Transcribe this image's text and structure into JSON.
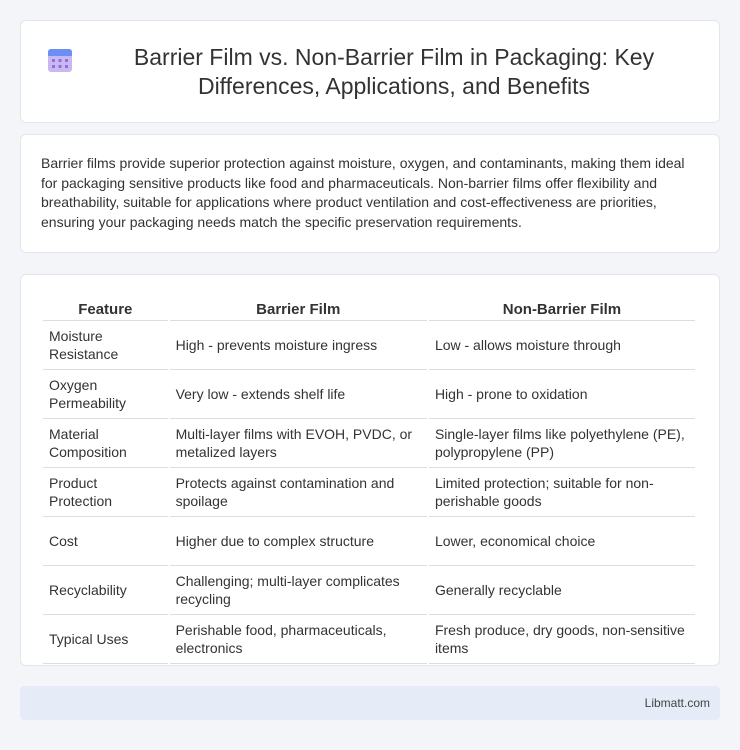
{
  "header": {
    "icon": "calendar-icon",
    "title": "Barrier Film vs. Non-Barrier Film in Packaging: Key Differences, Applications, and Benefits"
  },
  "intro": "Barrier films provide superior protection against moisture, oxygen, and contaminants, making them ideal for packaging sensitive products like food and pharmaceuticals. Non-barrier films offer flexibility and breathability, suitable for applications where product ventilation and cost-effectiveness are priorities, ensuring your packaging needs match the specific preservation requirements.",
  "table": {
    "headers": [
      "Feature",
      "Barrier Film",
      "Non-Barrier Film"
    ],
    "rows": [
      [
        "Moisture Resistance",
        "High - prevents moisture ingress",
        "Low - allows moisture through"
      ],
      [
        "Oxygen Permeability",
        "Very low - extends shelf life",
        "High - prone to oxidation"
      ],
      [
        "Material Composition",
        "Multi-layer films with EVOH, PVDC, or metalized layers",
        "Single-layer films like polyethylene (PE), polypropylene (PP)"
      ],
      [
        "Product Protection",
        "Protects against contamination and spoilage",
        "Limited protection; suitable for non-perishable goods"
      ],
      [
        "Cost",
        "Higher due to complex structure",
        "Lower, economical choice"
      ],
      [
        "Recyclability",
        "Challenging; multi-layer complicates recycling",
        "Generally recyclable"
      ],
      [
        "Typical Uses",
        "Perishable food, pharmaceuticals, electronics",
        "Fresh produce, dry goods, non-sensitive items"
      ]
    ]
  },
  "footer": {
    "brand": "Libmatt.com"
  },
  "colors": {
    "icon_top": "#6c8ef5",
    "icon_body": "#c9b8f2",
    "icon_dots": "#8a72d8"
  }
}
